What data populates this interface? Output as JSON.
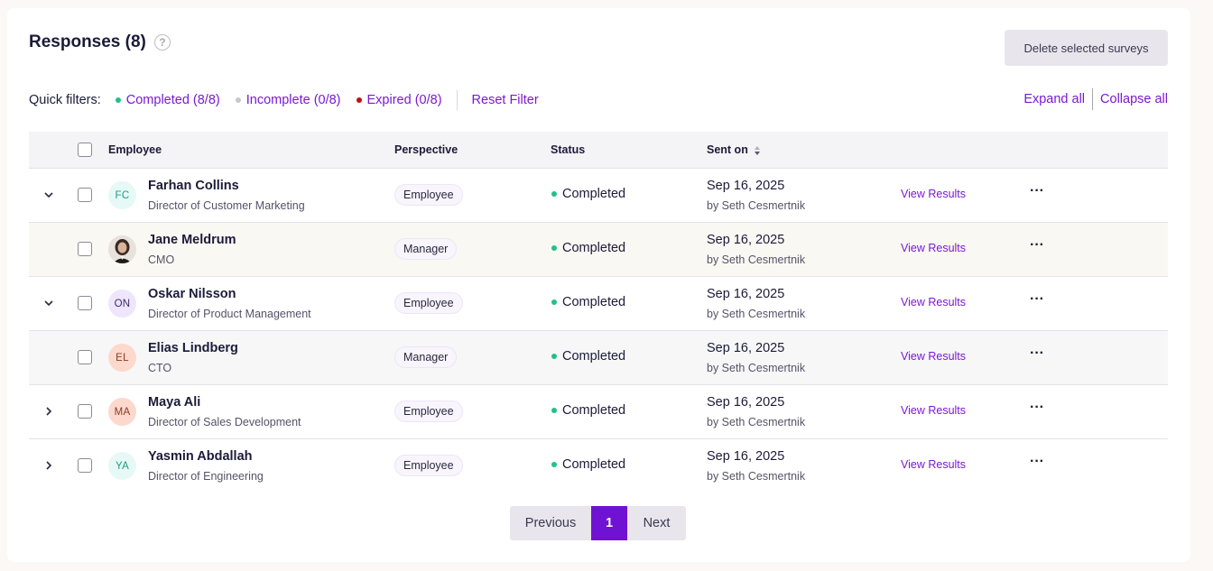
{
  "header": {
    "title": "Responses (8)",
    "help_icon": "question-circle-icon",
    "delete_button": "Delete selected surveys"
  },
  "filters": {
    "label": "Quick filters:",
    "items": [
      {
        "label": "Completed (8/8)",
        "color": "#22c08a"
      },
      {
        "label": "Incomplete (0/8)",
        "color": "#c8c6d0"
      },
      {
        "label": "Expired (0/8)",
        "color": "#c40d0d"
      }
    ],
    "reset": "Reset Filter",
    "expand_all": "Expand all",
    "collapse_all": "Collapse all"
  },
  "table": {
    "columns": {
      "employee": "Employee",
      "perspective": "Perspective",
      "status": "Status",
      "sent_on": "Sent on"
    },
    "rows": [
      {
        "name": "Farhan Collins",
        "role": "Director of Customer Marketing",
        "initials": "FC",
        "perspective": "Employee",
        "status": "Completed",
        "date": "Sep 16, 2025",
        "by": "by Seth Cesmertnik",
        "view": "View Results",
        "chevron": "chevron-down-icon"
      },
      {
        "name": "Jane Meldrum",
        "role": "CMO",
        "initials": "",
        "perspective": "Manager",
        "status": "Completed",
        "date": "Sep 16, 2025",
        "by": "by Seth Cesmertnik",
        "view": "View Results",
        "chevron": ""
      },
      {
        "name": "Oskar Nilsson",
        "role": "Director of Product Management",
        "initials": "ON",
        "perspective": "Employee",
        "status": "Completed",
        "date": "Sep 16, 2025",
        "by": "by Seth Cesmertnik",
        "view": "View Results",
        "chevron": "chevron-down-icon"
      },
      {
        "name": "Elias Lindberg",
        "role": "CTO",
        "initials": "EL",
        "perspective": "Manager",
        "status": "Completed",
        "date": "Sep 16, 2025",
        "by": "by Seth Cesmertnik",
        "view": "View Results",
        "chevron": ""
      },
      {
        "name": "Maya Ali",
        "role": "Director of Sales Development",
        "initials": "MA",
        "perspective": "Employee",
        "status": "Completed",
        "date": "Sep 16, 2025",
        "by": "by Seth Cesmertnik",
        "view": "View Results",
        "chevron": "chevron-right-icon"
      },
      {
        "name": "Yasmin Abdallah",
        "role": "Director of Engineering",
        "initials": "YA",
        "perspective": "Employee",
        "status": "Completed",
        "date": "Sep 16, 2025",
        "by": "by Seth Cesmertnik",
        "view": "View Results",
        "chevron": "chevron-right-icon"
      }
    ]
  },
  "pagination": {
    "previous": "Previous",
    "current": "1",
    "next": "Next"
  },
  "colors": {
    "accent": "#7b18d4",
    "page_active": "#6f12d4",
    "completed": "#22c08a"
  }
}
